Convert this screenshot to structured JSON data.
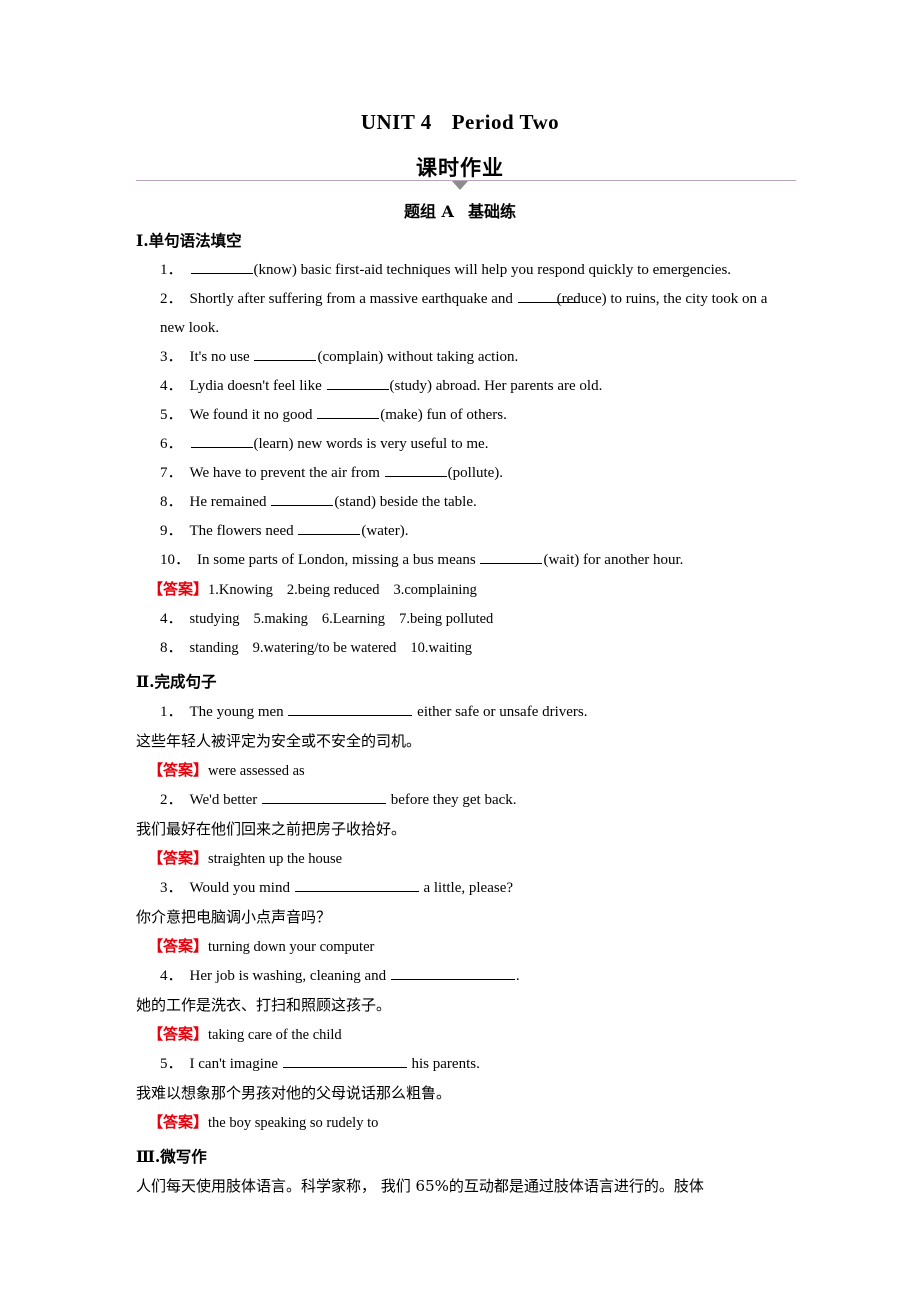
{
  "header": {
    "unit_title_left": "UNIT 4",
    "unit_title_right": "Period Two",
    "subtitle": "课时作业",
    "group_left": "题组 A",
    "group_right": "基础练",
    "divider_color": "#b9a3bd",
    "triangle_color": "#8c8c8c"
  },
  "answer_tag": "【答案】",
  "answer_tag_color": "#e8000d",
  "sections": [
    {
      "heading": "Ⅰ.单句语法填空",
      "items": [
        {
          "num": "1．",
          "pre": "",
          "hint": "(know) basic first-aid techniques will help you respond quickly to emergencies."
        },
        {
          "num": "2．",
          "pre": "Shortly after suffering from a massive earthquake and ",
          "hint": "(reduce) to ruins, the city took on a new look."
        },
        {
          "num": "3．",
          "pre": "It's no use ",
          "hint": "(complain) without taking action."
        },
        {
          "num": "4．",
          "pre": "Lydia doesn't feel like ",
          "hint": "(study) abroad. Her parents are old."
        },
        {
          "num": "5．",
          "pre": "We found it no good ",
          "hint": "(make) fun of others."
        },
        {
          "num": "6．",
          "pre": "",
          "hint": "(learn) new words is very useful to me."
        },
        {
          "num": "7．",
          "pre": "We have to prevent the air from ",
          "hint": "(pollute)."
        },
        {
          "num": "8．",
          "pre": "He remained ",
          "hint": "(stand) beside the table."
        },
        {
          "num": "9．",
          "pre": "The flowers need ",
          "hint": "(water)."
        },
        {
          "num": "10．",
          "pre": "In some parts of London, missing a bus means ",
          "hint": "(wait) for another hour."
        }
      ],
      "answers_line1": "1.Knowing",
      "answers_line1b": "2.being reduced",
      "answers_line1c": "3.complaining",
      "answers_line2_num": "4．",
      "answers_line2a": "studying",
      "answers_line2b": "5.making",
      "answers_line2c": "6.Learning",
      "answers_line2d": "7.being polluted",
      "answers_line3_num": "8．",
      "answers_line3a": "standing",
      "answers_line3b": "9.watering/to be watered",
      "answers_line3c": "10.waiting"
    },
    {
      "heading": "Ⅱ.完成句子",
      "items": [
        {
          "num": "1．",
          "pre": "The young men ",
          "post": " either safe or unsafe drivers.",
          "cn": "这些年轻人被评定为安全或不安全的司机。",
          "answer": "were assessed as"
        },
        {
          "num": "2．",
          "pre": "We'd better ",
          "post": " before they get back.",
          "cn": "我们最好在他们回来之前把房子收拾好。",
          "answer": "straighten up the house"
        },
        {
          "num": "3．",
          "pre": "Would you mind ",
          "post": " a little, please?",
          "cn": "你介意把电脑调小点声音吗？",
          "answer": "turning down your computer"
        },
        {
          "num": "4．",
          "pre": "Her job is washing, cleaning and ",
          "post": ".",
          "cn": "她的工作是洗衣、打扫和照顾这孩子。",
          "answer": "taking care of the child"
        },
        {
          "num": "5．",
          "pre": "I can't imagine ",
          "post": " his parents.",
          "cn": "我难以想象那个男孩对他的父母说话那么粗鲁。",
          "answer": "the boy speaking so rudely to"
        }
      ]
    },
    {
      "heading": "Ⅲ.微写作",
      "paragraph": "人们每天使用肢体语言。科学家称， 我们 65%的互动都是通过肢体语言进行的。肢体"
    }
  ]
}
